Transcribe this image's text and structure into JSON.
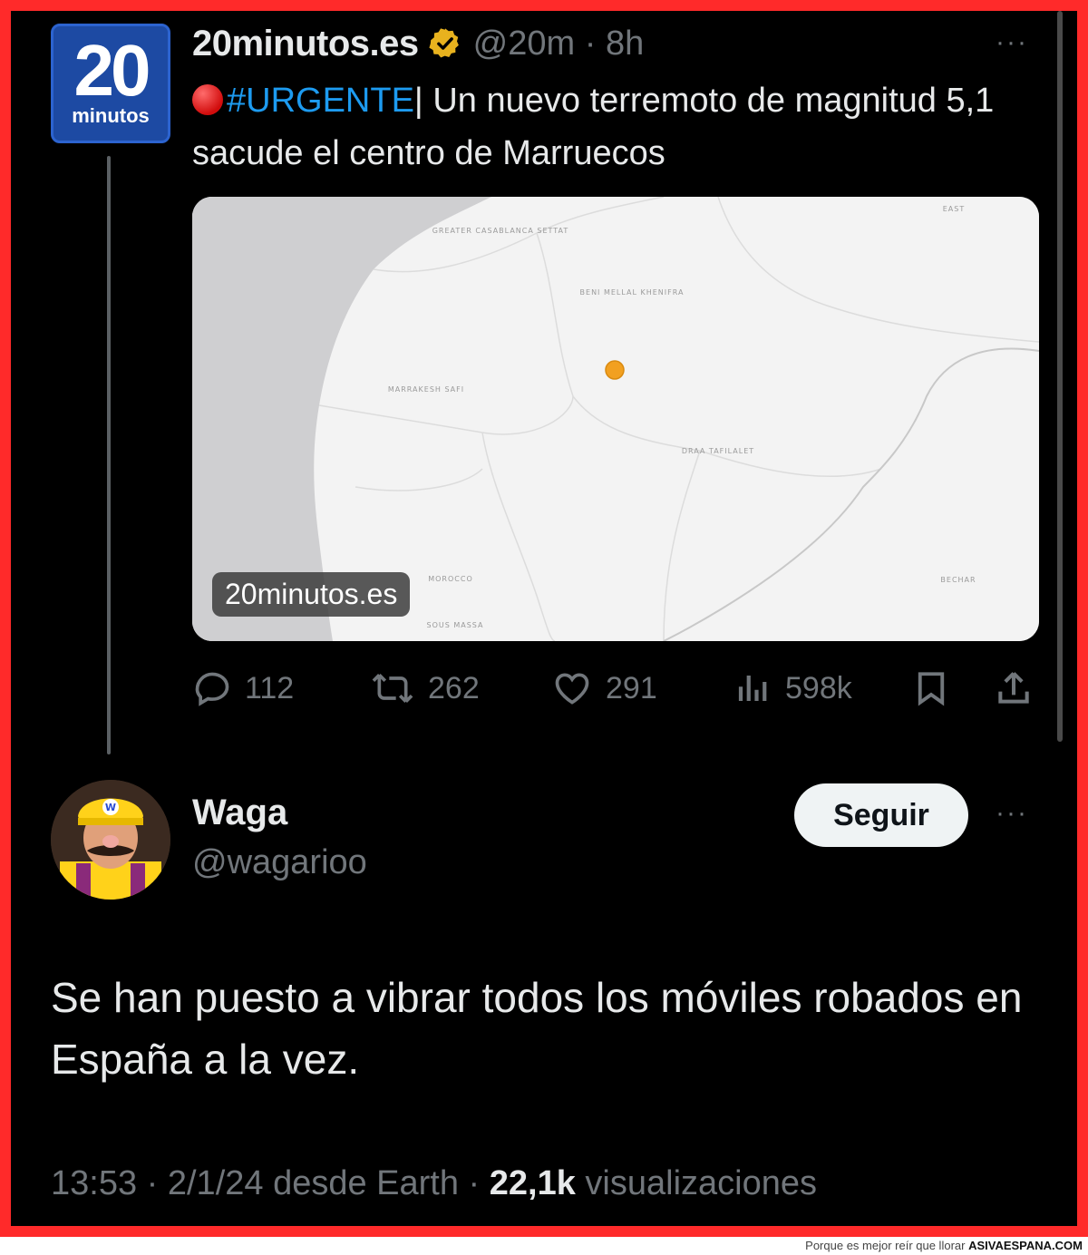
{
  "tweet": {
    "logo": {
      "number": "20",
      "word": "minutos"
    },
    "author_name": "20minutos.es",
    "handle": "@20m",
    "separator": "·",
    "time_ago": "8h",
    "more": "···",
    "hashtag": "#URGENTE",
    "pipe": "|",
    "text": "Un nuevo terremoto de magnitud 5,1 sacude el centro de Marruecos",
    "media_badge": "20minutos.es",
    "map_labels": [
      "GREATER CASABLANCA SETTAT",
      "BENI MELLAL KHENIFRA",
      "MARRAKESH SAFI",
      "DRAA TAFILALET",
      "MOROCCO",
      "SOUS MASSA",
      "EAST",
      "BECHAR"
    ],
    "stats": {
      "replies": "112",
      "reposts": "262",
      "likes": "291",
      "views": "598k"
    }
  },
  "reply": {
    "name": "Waga",
    "handle": "@wagarioo",
    "follow_label": "Seguir",
    "more": "···",
    "text": "Se han puesto a vibrar todos los móviles robados en España a la vez.",
    "meta_time": "13:53 · 2/1/24 desde Earth · ",
    "meta_views_count": "22,1k",
    "meta_views_label": " visualizaciones"
  },
  "watermark": {
    "caption": "Porque es mejor reír que llorar ",
    "brand": "ASIVAESPANA.COM"
  },
  "colors": {
    "accent": "#1d9bf0",
    "frame": "#ff2a2a",
    "background": "#000000",
    "muted": "#71767b",
    "text": "#e7e9ea"
  },
  "icons": [
    "verified-badge-icon",
    "reply-icon",
    "repost-icon",
    "like-icon",
    "views-icon",
    "bookmark-icon",
    "share-icon",
    "more-icon",
    "red-circle-emoji"
  ]
}
